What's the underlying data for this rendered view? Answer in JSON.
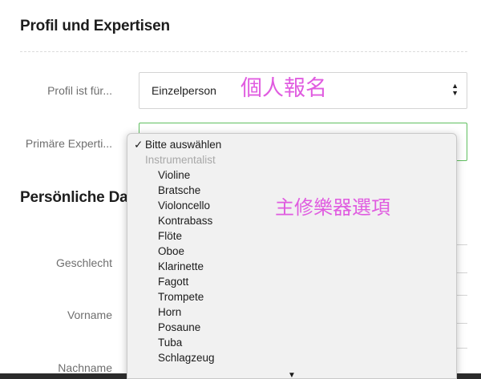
{
  "profile_section": {
    "title": "Profil und Expertisen",
    "profile_for": {
      "label": "Profil ist für...",
      "value": "Einzelperson"
    },
    "primary_expertise": {
      "label": "Primäre Experti..."
    }
  },
  "personal_section": {
    "title": "Persönliche Da",
    "gender_label": "Geschlecht",
    "firstname_label": "Vorname",
    "lastname_label": "Nachname"
  },
  "annotations": {
    "profile": "個人報名",
    "instruments": "主修樂器選項"
  },
  "dropdown": {
    "check_icon": "✓",
    "selected": "Bitte auswählen",
    "group_label": "Instrumentalist",
    "options": [
      "Violine",
      "Bratsche",
      "Violoncello",
      "Kontrabass",
      "Flöte",
      "Oboe",
      "Klarinette",
      "Fagott",
      "Trompete",
      "Horn",
      "Posaune",
      "Tuba",
      "Schlagzeug"
    ],
    "scroll_icon": "scroll-down-triangle-icon"
  },
  "colors": {
    "focus_border": "#5fbf5f",
    "annotation": "#e05ce0"
  }
}
